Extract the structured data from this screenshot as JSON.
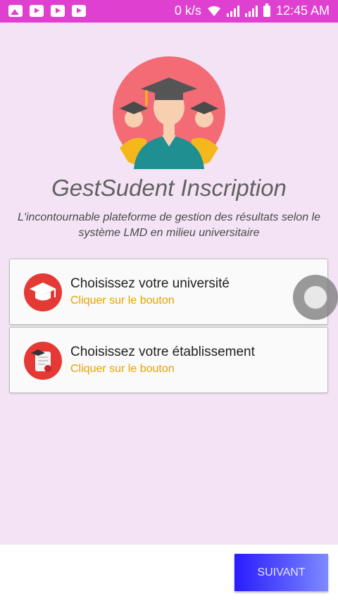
{
  "status_bar": {
    "speed": "0 k/s",
    "time": "12:45 AM",
    "left_icons": [
      "image-icon",
      "youtube-icon",
      "youtube-icon",
      "youtube-icon"
    ],
    "color": "#e040d0"
  },
  "header": {
    "title": "GestSudent Inscription",
    "subtitle": "L'incontournable plateforme de gestion des résultats selon le système LMD en milieu universitaire"
  },
  "cards": [
    {
      "title": "Choisissez votre université",
      "subtitle": "Cliquer sur le bouton",
      "icon": "graduation-cap-icon"
    },
    {
      "title": "Choisissez votre établissement",
      "subtitle": "Cliquer sur le bouton",
      "icon": "diploma-scroll-icon"
    }
  ],
  "footer": {
    "next_label": "SUIVANT"
  },
  "colors": {
    "background": "#f3e3f5",
    "accent_orange": "#e6a100",
    "button_blue": "#2a1cff"
  }
}
